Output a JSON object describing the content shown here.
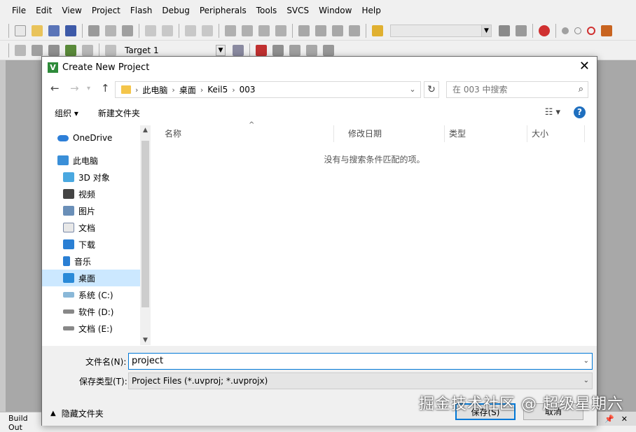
{
  "app": {
    "menu": [
      "File",
      "Edit",
      "View",
      "Project",
      "Flash",
      "Debug",
      "Peripherals",
      "Tools",
      "SVCS",
      "Window",
      "Help"
    ],
    "target_label": "Target 1",
    "build_output_label": "Build Out",
    "pin_icon": "pin-icon",
    "close_icon": "close-icon"
  },
  "dialog": {
    "title": "Create New Project",
    "address": {
      "crumbs": [
        "此电脑",
        "桌面",
        "Keil5",
        "003"
      ]
    },
    "search_placeholder": "在 003 中搜索",
    "commands": {
      "organize": "组织",
      "new_folder": "新建文件夹"
    },
    "nav": {
      "onedrive": "OneDrive",
      "this_pc": "此电脑",
      "objects3d": "3D 对象",
      "videos": "视频",
      "pictures": "图片",
      "documents": "文档",
      "downloads": "下载",
      "music": "音乐",
      "desktop": "桌面",
      "drive_c": "系统 (C:)",
      "drive_d": "软件 (D:)",
      "drive_e": "文档 (E:)"
    },
    "columns": {
      "name": "名称",
      "modified": "修改日期",
      "type": "类型",
      "size": "大小"
    },
    "empty_message": "没有与搜索条件匹配的项。",
    "filename_label": "文件名(N):",
    "filename_value": "project",
    "filetype_label": "保存类型(T):",
    "filetype_value": "Project Files (*.uvproj; *.uvprojx)",
    "hide_folders": "隐藏文件夹",
    "save_button": "保存(S)",
    "cancel_button": "取消"
  },
  "watermark": "掘金技术社区 @ 超级星期六"
}
